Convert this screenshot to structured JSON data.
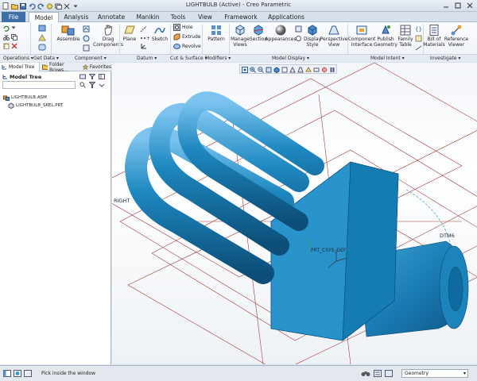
{
  "window": {
    "title": "LIGHTBULB (Active) - Creo Parametric"
  },
  "tabs": [
    {
      "label": "File"
    },
    {
      "label": "Model"
    },
    {
      "label": "Analysis"
    },
    {
      "label": "Annotate"
    },
    {
      "label": "Manikin"
    },
    {
      "label": "Tools"
    },
    {
      "label": "View"
    },
    {
      "label": "Framework"
    },
    {
      "label": "Applications"
    }
  ],
  "ribbon": {
    "assemble": "Assemble",
    "drag_components": "Drag\nComponents",
    "plane": "Plane",
    "sketch": "Sketch",
    "hole": "Hole",
    "extrude": "Extrude",
    "revolve": "Revolve",
    "pattern": "Pattern",
    "manage_views": "Manage\nViews",
    "section": "Section",
    "appearances": "Appearances",
    "display_style": "Display\nStyle",
    "perspective_view": "Perspective\nView",
    "component_interface": "Component\nInterface",
    "publish_geometry": "Publish\nGeometry",
    "family_table": "Family\nTable",
    "bill_of_materials": "Bill of\nMaterials",
    "reference_viewer": "Reference\nViewer",
    "groups": {
      "operations": "Operations ▾",
      "get_data": "Get Data ▾",
      "component": "Component ▾",
      "datum": "Datum ▾",
      "cut_surface": "Cut & Surface ▾",
      "modifiers": "Modifiers ▾",
      "model_display": "Model Display ▾",
      "model_intent": "Model Intent ▾",
      "investigate": "Investigate ▾"
    }
  },
  "panel": {
    "tabs": [
      "Model Tree",
      "Folder Brows...",
      "Favorites"
    ],
    "model_tree_label": "Model Tree",
    "search_placeholder": "",
    "items": [
      "LIGHTBULB.ASM",
      "LIGHTBULB_SKEL.PRT"
    ]
  },
  "viewport": {
    "datum_labels": [
      "PRT_CSYS_DEF",
      "DTM6",
      "RIGHT"
    ]
  },
  "status": {
    "message": "Pick inside the window",
    "filter_value": "Geometry"
  },
  "colors": {
    "model": "#1e88c0",
    "file_tab": "#3e6fa8",
    "datum": "#a04040"
  }
}
